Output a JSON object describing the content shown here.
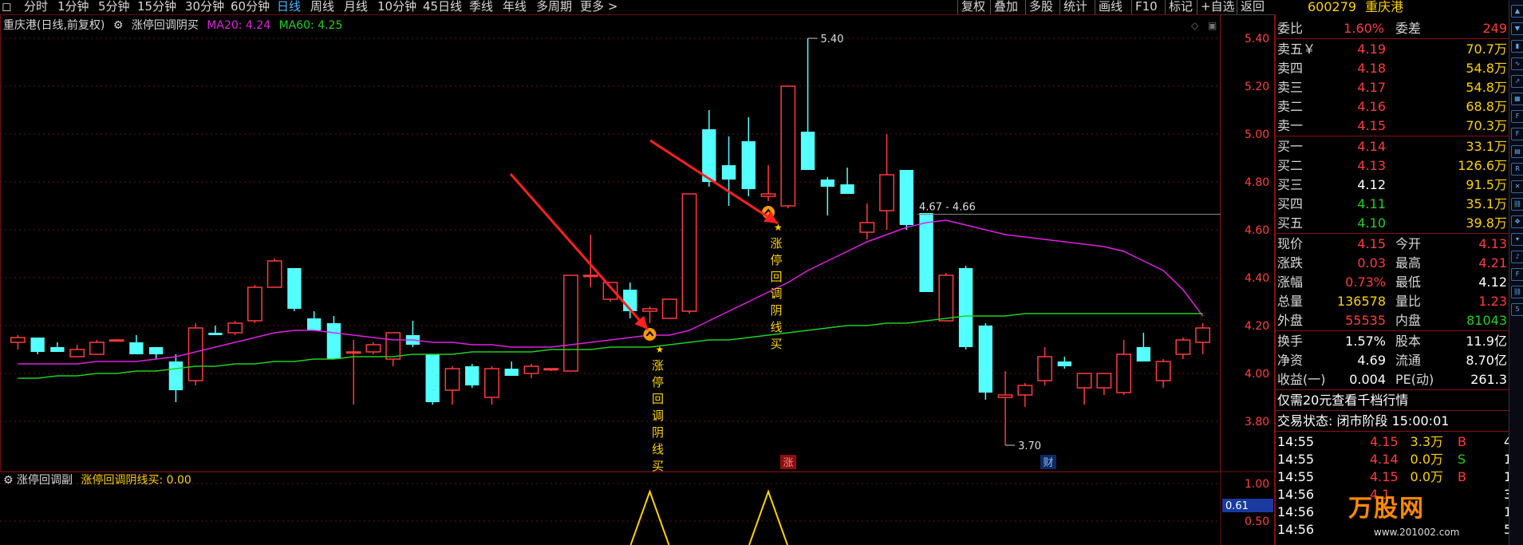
{
  "topbar": {
    "periods": [
      "分时",
      "1分钟",
      "5分钟",
      "15分钟",
      "30分钟",
      "60分钟",
      "日线",
      "周线",
      "月线",
      "10分钟",
      "45日线",
      "季线",
      "年线",
      "多周期",
      "更多 >"
    ],
    "active": "日线",
    "right_buttons": [
      "复权",
      "叠加",
      "多股",
      "统计",
      "画线",
      "F10",
      "标记",
      "+自选",
      "返回"
    ]
  },
  "legend": {
    "title": "重庆港(日线,前复权)",
    "indicator": "涨停回调阴买",
    "ma20": "MA20: 4.24",
    "ma60": "MA60: 4.25"
  },
  "colors": {
    "up": "#ff3b3b",
    "down": "#54ffff",
    "ma20": "#e020e0",
    "ma60": "#20d020",
    "grid": "#6a1010",
    "signal": "#ffd200"
  },
  "axis": {
    "ticks": [
      "5.40",
      "5.20",
      "5.00",
      "4.80",
      "4.60",
      "4.40",
      "4.20",
      "4.00",
      "3.80"
    ]
  },
  "annotations": {
    "high": "5.40",
    "low": "3.70",
    "range": "4.67 - 4.66",
    "signal_text": "涨停回调阴线买",
    "marker_zhang": "涨",
    "marker_cai": "财"
  },
  "chart_data": {
    "type": "candlestick",
    "ylim": [
      3.65,
      5.45
    ],
    "candles": [
      [
        4.13,
        4.16,
        4.1,
        4.15
      ],
      [
        4.15,
        4.15,
        4.08,
        4.09
      ],
      [
        4.11,
        4.13,
        4.09,
        4.09
      ],
      [
        4.07,
        4.12,
        4.07,
        4.1
      ],
      [
        4.08,
        4.14,
        4.08,
        4.13
      ],
      [
        4.14,
        4.14,
        4.14,
        4.14
      ],
      [
        4.13,
        4.16,
        4.08,
        4.08
      ],
      [
        4.11,
        4.11,
        4.06,
        4.08
      ],
      [
        4.05,
        4.08,
        3.88,
        3.93
      ],
      [
        3.97,
        4.21,
        3.95,
        4.19
      ],
      [
        4.17,
        4.2,
        4.16,
        4.16
      ],
      [
        4.17,
        4.22,
        4.16,
        4.21
      ],
      [
        4.22,
        4.37,
        4.21,
        4.36
      ],
      [
        4.36,
        4.48,
        4.36,
        4.47
      ],
      [
        4.44,
        4.44,
        4.26,
        4.27
      ],
      [
        4.23,
        4.26,
        4.18,
        4.18
      ],
      [
        4.21,
        4.24,
        4.07,
        4.06
      ],
      [
        4.09,
        4.14,
        3.87,
        4.09
      ],
      [
        4.09,
        4.13,
        4.08,
        4.12
      ],
      [
        4.06,
        4.16,
        4.03,
        4.17
      ],
      [
        4.16,
        4.22,
        4.11,
        4.12
      ],
      [
        4.08,
        4.08,
        3.87,
        3.88
      ],
      [
        3.93,
        4.03,
        3.87,
        4.02
      ],
      [
        4.03,
        4.04,
        3.94,
        3.95
      ],
      [
        3.9,
        4.03,
        3.87,
        4.02
      ],
      [
        4.02,
        4.05,
        3.99,
        3.99
      ],
      [
        4.0,
        4.04,
        3.98,
        4.03
      ],
      [
        4.02,
        4.02,
        4.01,
        4.02
      ],
      [
        4.01,
        4.41,
        4.01,
        4.41
      ],
      [
        4.41,
        4.58,
        4.36,
        4.41
      ],
      [
        4.31,
        4.38,
        4.3,
        4.38
      ],
      [
        4.35,
        4.38,
        4.23,
        4.26
      ],
      [
        4.26,
        4.28,
        4.21,
        4.27
      ],
      [
        4.23,
        4.31,
        4.23,
        4.31
      ],
      [
        4.26,
        4.75,
        4.25,
        4.75
      ],
      [
        5.02,
        5.1,
        4.78,
        4.8
      ],
      [
        4.87,
        4.99,
        4.7,
        4.81
      ],
      [
        4.97,
        5.07,
        4.74,
        4.77
      ],
      [
        4.74,
        4.87,
        4.72,
        4.75
      ],
      [
        4.7,
        5.2,
        4.69,
        5.2
      ],
      [
        5.01,
        5.4,
        4.85,
        4.85
      ],
      [
        4.81,
        4.82,
        4.66,
        4.78
      ],
      [
        4.79,
        4.86,
        4.75,
        4.75
      ],
      [
        4.59,
        4.71,
        4.56,
        4.63
      ],
      [
        4.68,
        5.0,
        4.6,
        4.83
      ],
      [
        4.85,
        4.85,
        4.6,
        4.62
      ],
      [
        4.67,
        4.67,
        4.34,
        4.34
      ],
      [
        4.22,
        4.42,
        4.22,
        4.41
      ],
      [
        4.44,
        4.45,
        4.1,
        4.11
      ],
      [
        4.2,
        4.21,
        3.89,
        3.92
      ],
      [
        3.9,
        4.01,
        3.7,
        3.91
      ],
      [
        3.91,
        3.96,
        3.86,
        3.95
      ],
      [
        3.97,
        4.11,
        3.95,
        4.07
      ],
      [
        4.05,
        4.07,
        4.02,
        4.03
      ],
      [
        3.94,
        4.0,
        3.87,
        4.0
      ],
      [
        3.94,
        4.0,
        3.91,
        4.0
      ],
      [
        3.92,
        4.14,
        3.91,
        4.08
      ],
      [
        4.11,
        4.17,
        4.06,
        4.05
      ],
      [
        3.97,
        4.06,
        3.94,
        4.05
      ],
      [
        4.08,
        4.15,
        4.06,
        4.14
      ],
      [
        4.13,
        4.21,
        4.08,
        4.19
      ]
    ],
    "ma20": [
      4.04,
      4.04,
      4.04,
      4.04,
      4.05,
      4.05,
      4.05,
      4.06,
      4.07,
      4.09,
      4.11,
      4.13,
      4.15,
      4.17,
      4.18,
      4.18,
      4.17,
      4.16,
      4.15,
      4.14,
      4.14,
      4.13,
      4.13,
      4.12,
      4.12,
      4.11,
      4.11,
      4.11,
      4.12,
      4.13,
      4.14,
      4.15,
      4.16,
      4.16,
      4.18,
      4.22,
      4.26,
      4.3,
      4.34,
      4.38,
      4.43,
      4.47,
      4.51,
      4.55,
      4.58,
      4.61,
      4.63,
      4.64,
      4.62,
      4.6,
      4.58,
      4.57,
      4.56,
      4.55,
      4.54,
      4.53,
      4.51,
      4.47,
      4.43,
      4.35,
      4.24
    ],
    "ma60": [
      3.98,
      3.98,
      3.99,
      3.99,
      4.0,
      4.0,
      4.01,
      4.01,
      4.02,
      4.03,
      4.03,
      4.04,
      4.04,
      4.05,
      4.05,
      4.06,
      4.06,
      4.07,
      4.07,
      4.07,
      4.08,
      4.08,
      4.08,
      4.09,
      4.09,
      4.09,
      4.09,
      4.1,
      4.1,
      4.1,
      4.11,
      4.11,
      4.11,
      4.12,
      4.13,
      4.14,
      4.14,
      4.15,
      4.16,
      4.17,
      4.18,
      4.19,
      4.2,
      4.2,
      4.21,
      4.21,
      4.22,
      4.23,
      4.24,
      4.24,
      4.24,
      4.25,
      4.25,
      4.25,
      4.25,
      4.25,
      4.25,
      4.25,
      4.25,
      4.25,
      4.25
    ],
    "signals": [
      32,
      38
    ],
    "sub_ticks": [
      "1.00",
      "0.50"
    ],
    "sub_current": "0.61"
  },
  "sub": {
    "title": "涨停回调副",
    "value": "涨停回调阴线买: 0.00"
  },
  "quote": {
    "code": "600279",
    "name": "重庆港",
    "weibi_label": "委比",
    "weibi": "1.60%",
    "weicha_label": "委差",
    "weicha": "249",
    "asks": [
      {
        "label": "卖五￥",
        "price": "4.19",
        "vol": "70.7万"
      },
      {
        "label": "卖四",
        "price": "4.18",
        "vol": "54.8万"
      },
      {
        "label": "卖三",
        "price": "4.17",
        "vol": "54.8万"
      },
      {
        "label": "卖二",
        "price": "4.16",
        "vol": "68.8万"
      },
      {
        "label": "卖一",
        "price": "4.15",
        "vol": "70.3万"
      }
    ],
    "bids": [
      {
        "label": "买一",
        "price": "4.14",
        "vol": "33.1万",
        "c": "#ff3b3b"
      },
      {
        "label": "买二",
        "price": "4.13",
        "vol": "126.6万",
        "c": "#ff3b3b"
      },
      {
        "label": "买三",
        "price": "4.12",
        "vol": "91.5万",
        "c": "#ffffff"
      },
      {
        "label": "买四",
        "price": "4.11",
        "vol": "35.1万",
        "c": "#20d020"
      },
      {
        "label": "买五",
        "price": "4.10",
        "vol": "39.8万",
        "c": "#20d020"
      }
    ],
    "stats": [
      {
        "l": "现价",
        "v": "4.15",
        "vc": "#ff3b3b",
        "l2": "今开",
        "v2": "4.13",
        "v2c": "#ff3b3b"
      },
      {
        "l": "涨跌",
        "v": "0.03",
        "vc": "#ff3b3b",
        "l2": "最高",
        "v2": "4.21",
        "v2c": "#ff3b3b"
      },
      {
        "l": "涨幅",
        "v": "0.73%",
        "vc": "#ff3b3b",
        "l2": "最低",
        "v2": "4.12",
        "v2c": "#ffffff"
      },
      {
        "l": "总量",
        "v": "136578",
        "vc": "#ffd200",
        "l2": "量比",
        "v2": "1.23",
        "v2c": "#ff3b3b"
      },
      {
        "l": "外盘",
        "v": "55535",
        "vc": "#ff3b3b",
        "l2": "内盘",
        "v2": "81043",
        "v2c": "#20d020"
      }
    ],
    "stats2": [
      {
        "l": "换手",
        "v": "1.57%",
        "l2": "股本",
        "v2": "11.9亿"
      },
      {
        "l": "净资",
        "v": "4.69",
        "l2": "流通",
        "v2": "8.70亿"
      },
      {
        "l": "收益(一)",
        "v": "0.004",
        "l2": "PE(动)",
        "v2": "261.3"
      }
    ],
    "promo": "仅需20元查看千档行情",
    "status": "交易状态: 闭市阶段 15:00:01",
    "ticks": [
      {
        "t": "14:55",
        "p": "4.15",
        "pc": "#ff3b3b",
        "v": "3.3万",
        "s": "B",
        "sc": "#ff3b3b",
        "n": "4"
      },
      {
        "t": "14:55",
        "p": "4.14",
        "pc": "#ff3b3b",
        "v": "0.0万",
        "s": "S",
        "sc": "#20d020",
        "n": "1"
      },
      {
        "t": "14:55",
        "p": "4.15",
        "pc": "#ff3b3b",
        "v": "0.0万",
        "s": "B",
        "sc": "#ff3b3b",
        "n": "1"
      },
      {
        "t": "14:56",
        "p": "4.1",
        "pc": "#ff3b3b",
        "v": "",
        "s": "",
        "sc": "#ff3b3b",
        "n": "3"
      },
      {
        "t": "14:56",
        "p": "",
        "pc": "#ff3b3b",
        "v": "",
        "s": "",
        "sc": "#ff3b3b",
        "n": "1"
      },
      {
        "t": "14:56",
        "p": "",
        "pc": "#ff3b3b",
        "v": "",
        "s": "",
        "sc": "#ff3b3b",
        "n": "5"
      }
    ]
  },
  "watermark": {
    "brand": "万股网",
    "url": "www.201002.com"
  },
  "toolbar_icons": [
    "arrow-up-icon",
    "arrow-down-icon",
    "bar-icon",
    "line-icon",
    "trend-icon",
    "grid-icon",
    "f10-icon",
    "fi-icon",
    "chart-icon",
    "rs-icon",
    "delete-icon",
    "link-icon",
    "move-icon",
    "down-icon",
    "bell-icon",
    "fs-icon",
    "link2-icon",
    "five-icon"
  ]
}
